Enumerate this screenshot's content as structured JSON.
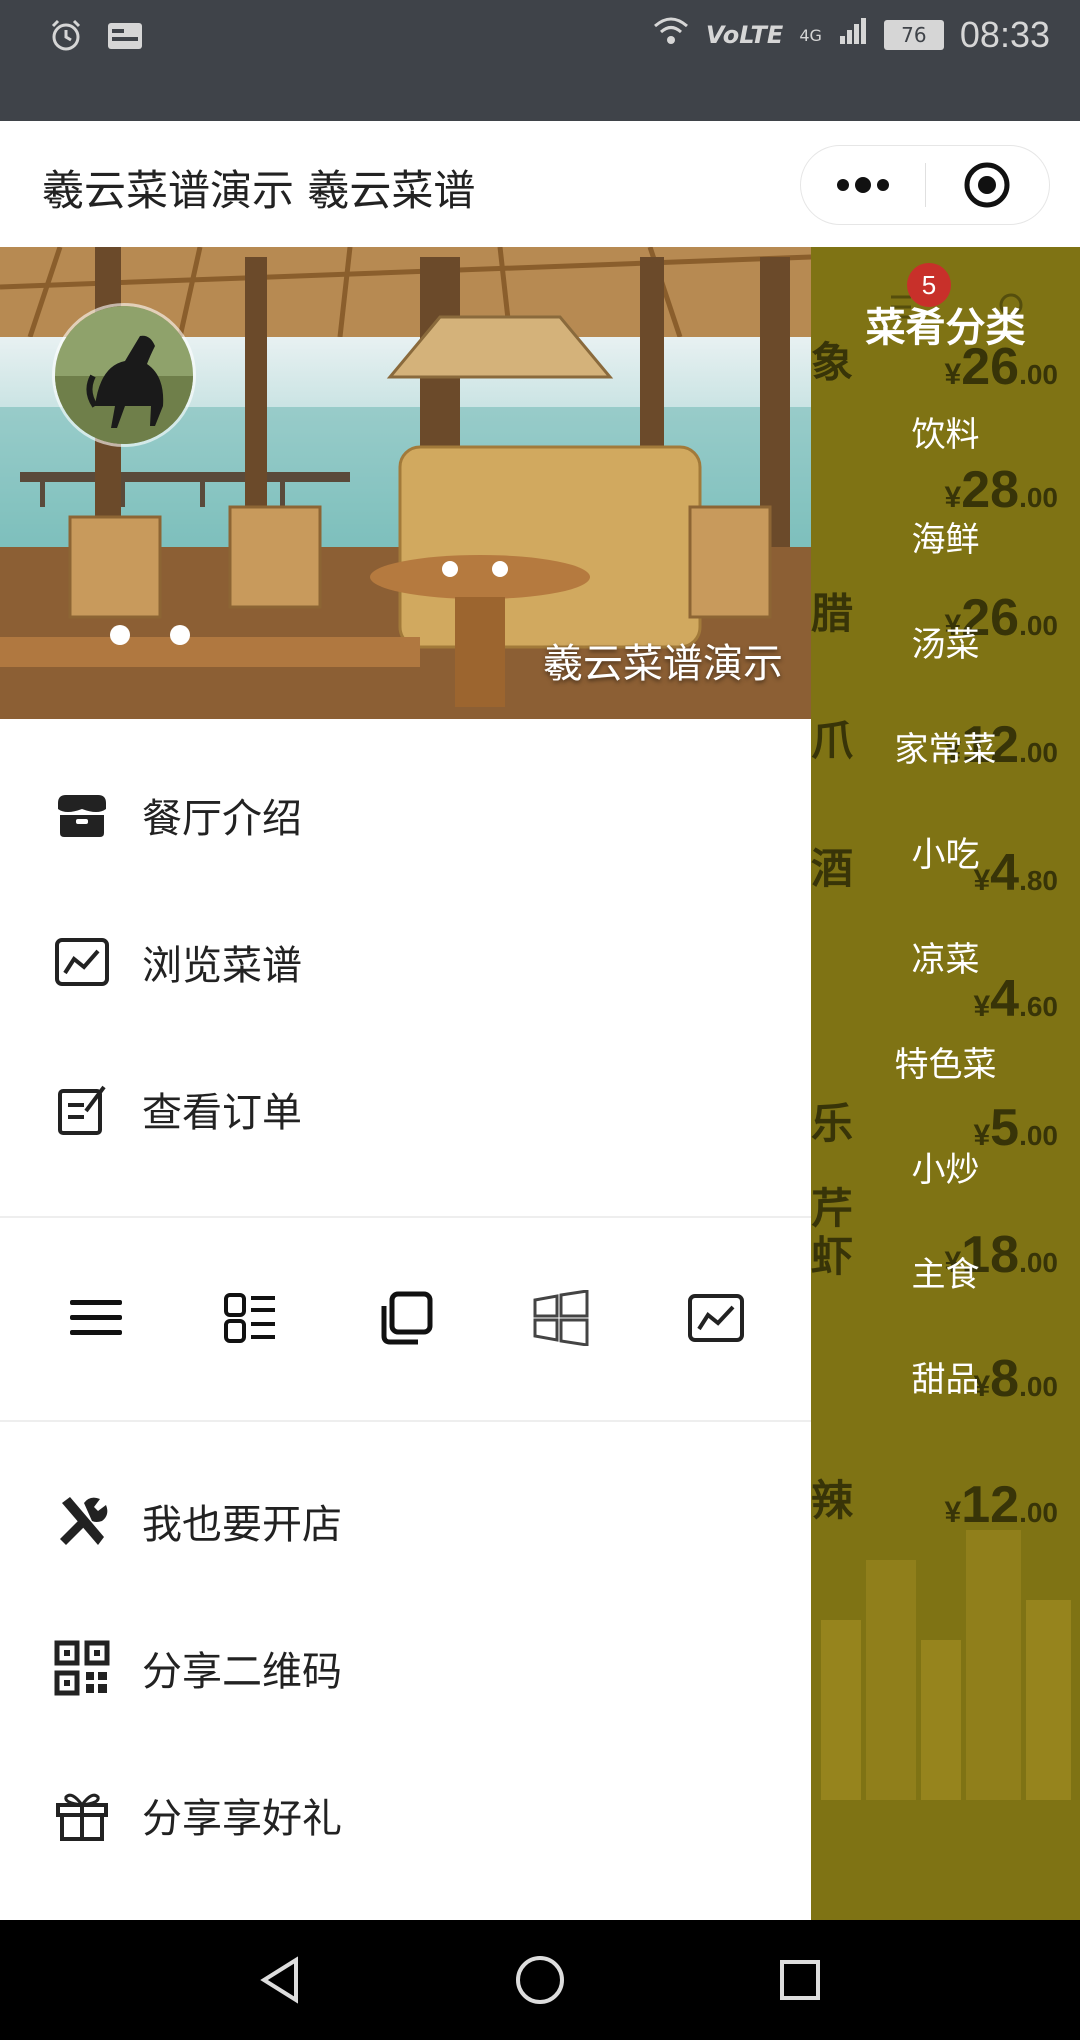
{
  "status_bar": {
    "time": "08:33",
    "battery": "76",
    "network": "4G",
    "volte": "VoLTE",
    "icons": [
      "alarm-icon",
      "image-icon",
      "wifi-icon",
      "signal-icon",
      "battery-icon"
    ]
  },
  "titlebar": {
    "title": "羲云菜谱演示 羲云菜谱",
    "more_icon": "more-dots-icon",
    "close_icon": "target-circle-icon"
  },
  "hero": {
    "caption": "羲云菜谱演示",
    "avatar_icon": "horse-avatar"
  },
  "menu_top": [
    {
      "label": "餐厅介绍",
      "icon": "store-icon"
    },
    {
      "label": "浏览菜谱",
      "icon": "chart-image-icon"
    },
    {
      "label": "查看订单",
      "icon": "edit-note-icon"
    }
  ],
  "icon_row": [
    "menu-lines-icon",
    "list-grid-icon",
    "copy-icon",
    "windows-icon",
    "chart-image-icon"
  ],
  "menu_bottom": [
    {
      "label": "我也要开店",
      "icon": "tools-icon"
    },
    {
      "label": "分享二维码",
      "icon": "qrcode-icon"
    },
    {
      "label": "分享享好礼",
      "icon": "gift-icon"
    }
  ],
  "category_panel": {
    "title": "菜肴分类",
    "badge": "5",
    "categories": [
      "饮料",
      "海鲜",
      "汤菜",
      "家常菜",
      "小吃",
      "凉菜",
      "特色菜",
      "小炒",
      "主食",
      "甜品"
    ]
  },
  "background_prices": [
    {
      "char": "象",
      "yen": "¥",
      "int": "26",
      "dec": ".00"
    },
    {
      "char": "",
      "yen": "¥",
      "int": "28",
      "dec": ".00"
    },
    {
      "char": "腊",
      "yen": "¥",
      "int": "26",
      "dec": ".00"
    },
    {
      "char": "爪",
      "yen": "¥",
      "int": "12",
      "dec": ".00"
    },
    {
      "char": "酒",
      "yen": "¥",
      "int": "4",
      "dec": ".80"
    },
    {
      "char": "",
      "yen": "¥",
      "int": "4",
      "dec": ".60"
    },
    {
      "char": "乐",
      "yen": "¥",
      "int": "5",
      "dec": ".00"
    },
    {
      "char": "芹虾",
      "yen": "¥",
      "int": "18",
      "dec": ".00"
    },
    {
      "char": "",
      "yen": "¥",
      "int": "8",
      "dec": ".00"
    },
    {
      "char": "辣",
      "yen": "¥",
      "int": "12",
      "dec": ".00"
    }
  ],
  "nav_bar": {
    "icons": [
      "back-triangle-icon",
      "home-circle-icon",
      "recents-square-icon"
    ]
  }
}
